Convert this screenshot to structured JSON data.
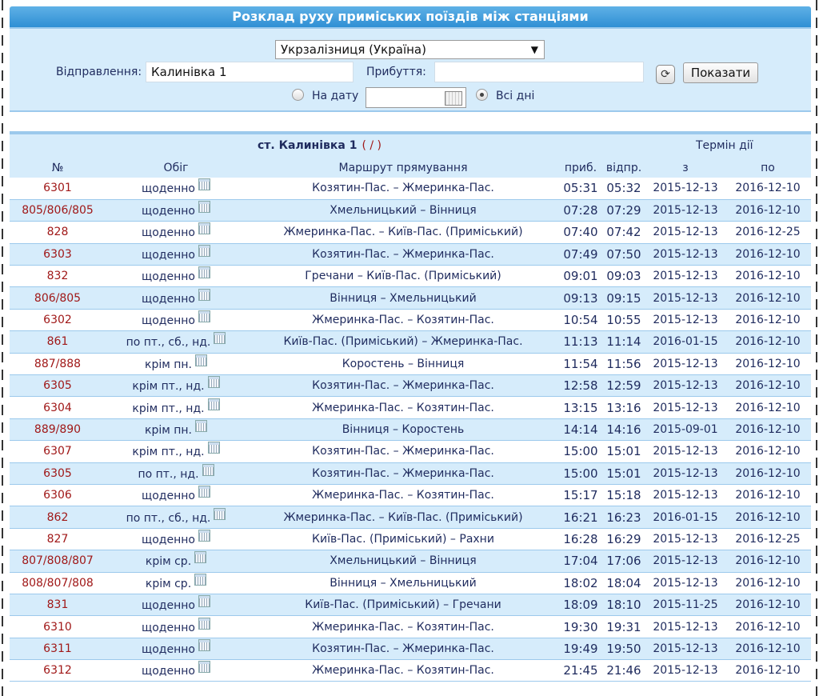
{
  "title": "Розклад руху приміських поїздів між станціями",
  "search": {
    "railway": "Укрзалізниця (Україна)",
    "departure_label": "Відправлення:",
    "departure_value": "Калинівка 1",
    "arrival_label": "Прибуття:",
    "arrival_value": "",
    "submit_label": "Показати",
    "on_date_label": "На дату",
    "date_value": "",
    "all_days_label": "Всі дні",
    "selected_mode": "all_days"
  },
  "table": {
    "station": "ст. Калинівка 1",
    "station_links": "( / )",
    "validity_header": "Термін дії",
    "headers": {
      "num": "№",
      "freq": "Обіг",
      "route": "Маршрут прямування",
      "arr": "приб.",
      "dep": "відпр.",
      "from": "з",
      "to": "по"
    },
    "rows": [
      {
        "num": "6301",
        "freq": "щоденно",
        "route": "Козятин-Пас. – Жмеринка-Пас.",
        "arr": "05:31",
        "dep": "05:32",
        "from": "2015-12-13",
        "to": "2016-12-10"
      },
      {
        "num": "805/806/805",
        "freq": "щоденно",
        "route": "Хмельницький – Вінниця",
        "arr": "07:28",
        "dep": "07:29",
        "from": "2015-12-13",
        "to": "2016-12-10"
      },
      {
        "num": "828",
        "freq": "щоденно",
        "route": "Жмеринка-Пас. – Київ-Пас. (Приміський)",
        "arr": "07:40",
        "dep": "07:42",
        "from": "2015-12-13",
        "to": "2016-12-25"
      },
      {
        "num": "6303",
        "freq": "щоденно",
        "route": "Козятин-Пас. – Жмеринка-Пас.",
        "arr": "07:49",
        "dep": "07:50",
        "from": "2015-12-13",
        "to": "2016-12-10"
      },
      {
        "num": "832",
        "freq": "щоденно",
        "route": "Гречани – Київ-Пас. (Приміський)",
        "arr": "09:01",
        "dep": "09:03",
        "from": "2015-12-13",
        "to": "2016-12-10"
      },
      {
        "num": "806/805",
        "freq": "щоденно",
        "route": "Вінниця – Хмельницький",
        "arr": "09:13",
        "dep": "09:15",
        "from": "2015-12-13",
        "to": "2016-12-10"
      },
      {
        "num": "6302",
        "freq": "щоденно",
        "route": "Жмеринка-Пас. – Козятин-Пас.",
        "arr": "10:54",
        "dep": "10:55",
        "from": "2015-12-13",
        "to": "2016-12-10"
      },
      {
        "num": "861",
        "freq": "по пт., сб., нд.",
        "route": "Київ-Пас. (Приміський) – Жмеринка-Пас.",
        "arr": "11:13",
        "dep": "11:14",
        "from": "2016-01-15",
        "to": "2016-12-10"
      },
      {
        "num": "887/888",
        "freq": "крім пн.",
        "route": "Коростень – Вінниця",
        "arr": "11:54",
        "dep": "11:56",
        "from": "2015-12-13",
        "to": "2016-12-10"
      },
      {
        "num": "6305",
        "freq": "крім пт., нд.",
        "route": "Козятин-Пас. – Жмеринка-Пас.",
        "arr": "12:58",
        "dep": "12:59",
        "from": "2015-12-13",
        "to": "2016-12-10"
      },
      {
        "num": "6304",
        "freq": "крім пт., нд.",
        "route": "Жмеринка-Пас. – Козятин-Пас.",
        "arr": "13:15",
        "dep": "13:16",
        "from": "2015-12-13",
        "to": "2016-12-10"
      },
      {
        "num": "889/890",
        "freq": "крім пн.",
        "route": "Вінниця – Коростень",
        "arr": "14:14",
        "dep": "14:16",
        "from": "2015-09-01",
        "to": "2016-12-10"
      },
      {
        "num": "6307",
        "freq": "крім пт., нд.",
        "route": "Козятин-Пас. – Жмеринка-Пас.",
        "arr": "15:00",
        "dep": "15:01",
        "from": "2015-12-13",
        "to": "2016-12-10"
      },
      {
        "num": "6305",
        "freq": "по пт., нд.",
        "route": "Козятин-Пас. – Жмеринка-Пас.",
        "arr": "15:00",
        "dep": "15:01",
        "from": "2015-12-13",
        "to": "2016-12-10"
      },
      {
        "num": "6306",
        "freq": "щоденно",
        "route": "Жмеринка-Пас. – Козятин-Пас.",
        "arr": "15:17",
        "dep": "15:18",
        "from": "2015-12-13",
        "to": "2016-12-10"
      },
      {
        "num": "862",
        "freq": "по пт., сб., нд.",
        "route": "Жмеринка-Пас. – Київ-Пас. (Приміський)",
        "arr": "16:21",
        "dep": "16:23",
        "from": "2016-01-15",
        "to": "2016-12-10"
      },
      {
        "num": "827",
        "freq": "щоденно",
        "route": "Київ-Пас. (Приміський) – Рахни",
        "arr": "16:28",
        "dep": "16:29",
        "from": "2015-12-13",
        "to": "2016-12-25"
      },
      {
        "num": "807/808/807",
        "freq": "крім ср.",
        "route": "Хмельницький – Вінниця",
        "arr": "17:04",
        "dep": "17:06",
        "from": "2015-12-13",
        "to": "2016-12-10"
      },
      {
        "num": "808/807/808",
        "freq": "крім ср.",
        "route": "Вінниця – Хмельницький",
        "arr": "18:02",
        "dep": "18:04",
        "from": "2015-12-13",
        "to": "2016-12-10"
      },
      {
        "num": "831",
        "freq": "щоденно",
        "route": "Київ-Пас. (Приміський) – Гречани",
        "arr": "18:09",
        "dep": "18:10",
        "from": "2015-11-25",
        "to": "2016-12-10"
      },
      {
        "num": "6310",
        "freq": "щоденно",
        "route": "Жмеринка-Пас. – Козятин-Пас.",
        "arr": "19:30",
        "dep": "19:31",
        "from": "2015-12-13",
        "to": "2016-12-10"
      },
      {
        "num": "6311",
        "freq": "щоденно",
        "route": "Козятин-Пас. – Жмеринка-Пас.",
        "arr": "19:49",
        "dep": "19:50",
        "from": "2015-12-13",
        "to": "2016-12-10"
      },
      {
        "num": "6312",
        "freq": "щоденно",
        "route": "Жмеринка-Пас. – Козятин-Пас.",
        "arr": "21:45",
        "dep": "21:46",
        "from": "2015-12-13",
        "to": "2016-12-10"
      }
    ]
  }
}
